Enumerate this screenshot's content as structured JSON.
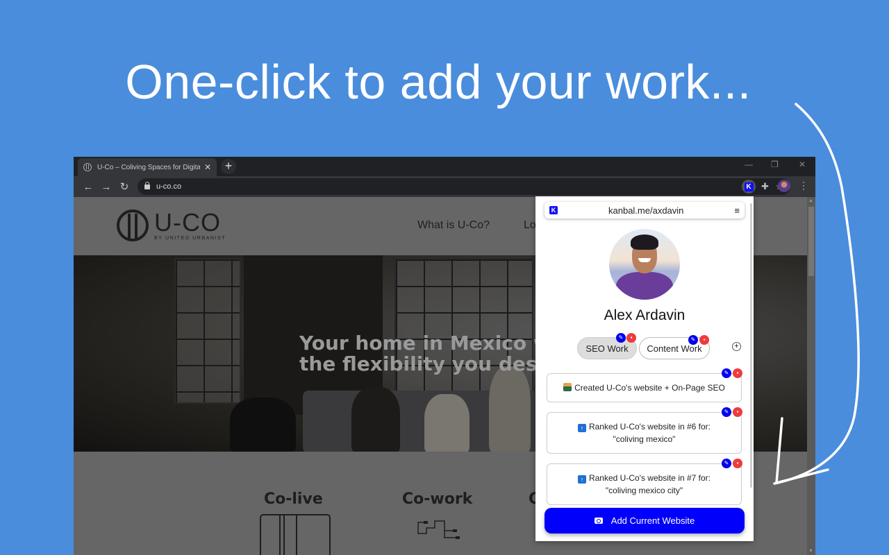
{
  "headline": "One-click to add your work...",
  "browser": {
    "tab_title": "U-Co – Coliving Spaces for Digita",
    "tab_close": "✕",
    "new_tab": "+",
    "window_controls": [
      "—",
      "❐",
      "✕"
    ],
    "nav": {
      "back": "←",
      "forward": "→",
      "reload": "↻"
    },
    "url": "u-co.co",
    "bookmark_star": "☆",
    "extension_badge": "K",
    "puzzle": "✚",
    "menu": "⋮"
  },
  "website": {
    "logo_text": "U-CO",
    "logo_sub": "BY UNITED URBANIST",
    "nav_links": [
      "What is U-Co?",
      "Lo"
    ],
    "hero_line1": "Your home in Mexico w",
    "hero_line2": "the flexibility you dese",
    "services": [
      "Co-live",
      "Co-work",
      "C"
    ]
  },
  "popup": {
    "brand_badge": "K",
    "url": "kanbal.me/axdavin",
    "menu_icon": "≡",
    "profile_name": "Alex Ardavin",
    "categories": [
      {
        "label": "SEO Work",
        "active": true
      },
      {
        "label": "Content Work",
        "active": false
      }
    ],
    "add_category": "+",
    "edit_glyph": "✎",
    "delete_glyph": "🗑",
    "work_items": [
      {
        "emoji": "technologist",
        "line1": "Created U-Co's website + On-Page SEO",
        "line2": ""
      },
      {
        "emoji": "up-arrow",
        "line1": "Ranked U-Co's website in #6 for:",
        "line2": "\"coliving mexico\""
      },
      {
        "emoji": "up-arrow",
        "line1": "Ranked U-Co's website in #7 for:",
        "line2": "\"coliving mexico city\""
      }
    ],
    "up_glyph": "↑",
    "add_button": "Add Current Website"
  },
  "colors": {
    "background": "#4a8ddc",
    "accent_blue": "#0000fb",
    "delete_red": "#ef3b3b"
  }
}
